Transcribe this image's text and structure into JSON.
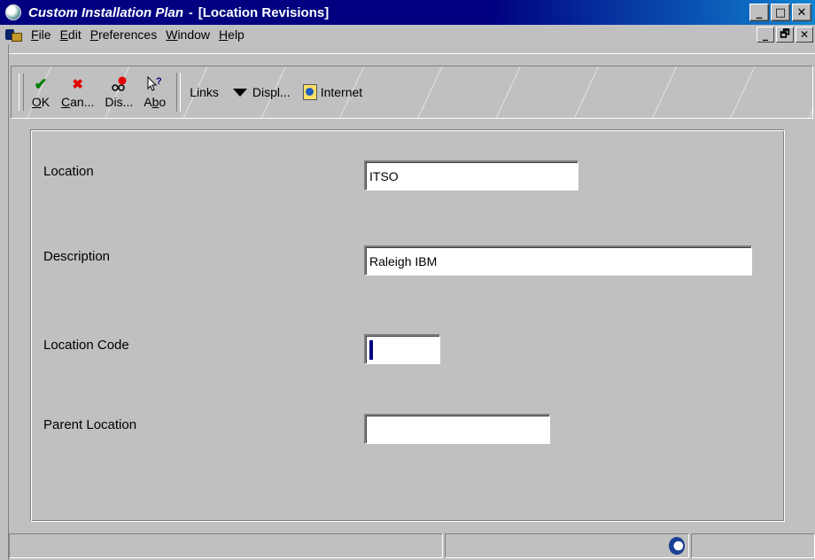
{
  "window": {
    "app_title": "Custom Installation Plan",
    "separator": "-",
    "document_title": "[Location Revisions]",
    "controls": [
      "_",
      "□",
      "✕"
    ],
    "mdi_controls": [
      "_",
      "🗗",
      "✕"
    ]
  },
  "menu": {
    "items": [
      {
        "label": "File",
        "underline": "F",
        "rest": "ile"
      },
      {
        "label": "Edit",
        "underline": "E",
        "rest": "dit"
      },
      {
        "label": "Preferences",
        "underline": "P",
        "rest": "references"
      },
      {
        "label": "Window",
        "underline": "W",
        "rest": "indow"
      },
      {
        "label": "Help",
        "underline": "H",
        "rest": "elp"
      }
    ]
  },
  "toolbar": {
    "buttons": [
      {
        "label_u": "O",
        "label_rest": "K",
        "icon": "checkmark-icon",
        "glyph": "✔",
        "color": "#008000"
      },
      {
        "label_u": "C",
        "label_rest": "an...",
        "icon": "cancel-x-icon",
        "glyph": "✖",
        "color": "#e00000"
      },
      {
        "label_u": "",
        "label_rest": "Dis...",
        "icon": "display-eyeglasses-icon",
        "glyph": "ಠ",
        "color": "#000000"
      },
      {
        "label_u": "",
        "label_rest": "Abo",
        "icon": "about-help-icon",
        "glyph": "?",
        "color": "#000080"
      }
    ],
    "links_label": "Links",
    "display_label": "Displ...",
    "internet_label": "Internet"
  },
  "form": {
    "location": {
      "label": "Location",
      "value": "ITSO"
    },
    "description": {
      "label": "Description",
      "value": "Raleigh IBM"
    },
    "location_code": {
      "label": "Location Code",
      "value": ""
    },
    "parent_location": {
      "label": "Parent Location",
      "value": ""
    }
  }
}
